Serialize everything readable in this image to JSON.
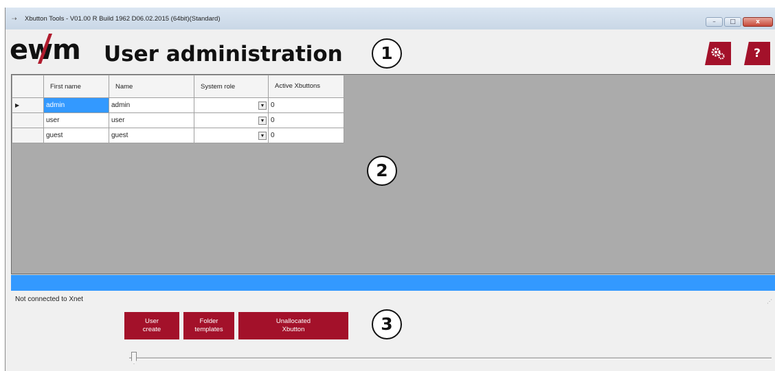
{
  "window": {
    "title": "Xbutton Tools - V01.00 R Build 1962 D06.02.2015 (64bit)(Standard)",
    "icon": "xbutton-app-icon",
    "controls": {
      "minimize": "–",
      "maximize": "□",
      "close": "x"
    }
  },
  "header": {
    "logo": "ewm",
    "title": "User administration",
    "settings_icon": "gears-icon",
    "help_label": "?"
  },
  "callouts": [
    "1",
    "2",
    "3"
  ],
  "table": {
    "columns": [
      "First name",
      "Name",
      "System role",
      "Active Xbuttons"
    ],
    "rows": [
      {
        "first_name": "admin",
        "name": "admin",
        "system_role": "",
        "active_xbuttons": "0",
        "current": true
      },
      {
        "first_name": "user",
        "name": "user",
        "system_role": "",
        "active_xbuttons": "0",
        "current": false
      },
      {
        "first_name": "guest",
        "name": "guest",
        "system_role": "",
        "active_xbuttons": "0",
        "current": false
      }
    ],
    "current_row_marker": "▶",
    "dropdown_glyph": "▼"
  },
  "progress": {
    "value": 1.0
  },
  "status": {
    "text": "Not connected to Xnet"
  },
  "actions": {
    "user_create": "User\ncreate",
    "folder_templates": "Folder\ntemplates",
    "unallocated_xbutton": "Unallocated\nXbutton"
  },
  "slider": {
    "value": 0
  },
  "colors": {
    "accent": "#a3112a",
    "selection": "#3399ff",
    "grid_background": "#ababab"
  }
}
